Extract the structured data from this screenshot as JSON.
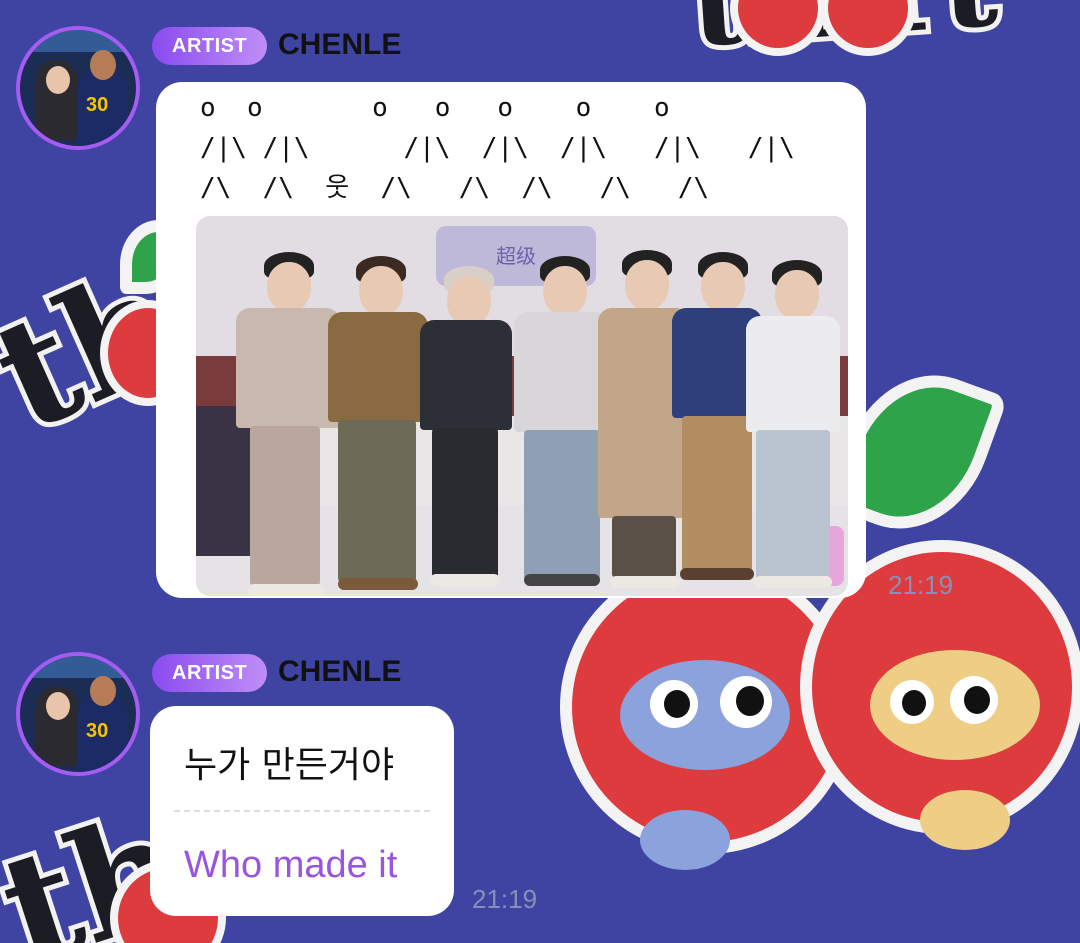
{
  "wallpaper": {
    "deco_word": "thirt"
  },
  "messages": [
    {
      "badge": "ARTIST",
      "sender": "CHENLE",
      "ascii_art": "o  o       o   o   o    o    o\n/|\\ /|\\      /|\\  /|\\  /|\\   /|\\   /|\\\n/\\  /\\  웃  /\\   /\\  /\\   /\\   /\\",
      "photo_sign": "超级",
      "time": "21:19"
    },
    {
      "badge": "ARTIST",
      "sender": "CHENLE",
      "text_ko": "누가 만든거야",
      "text_en": "Who made it",
      "time": "21:19"
    }
  ],
  "colors": {
    "background": "#3f44a3",
    "badge_accent": "#8a4bf0",
    "translation": "#9a55e0"
  }
}
